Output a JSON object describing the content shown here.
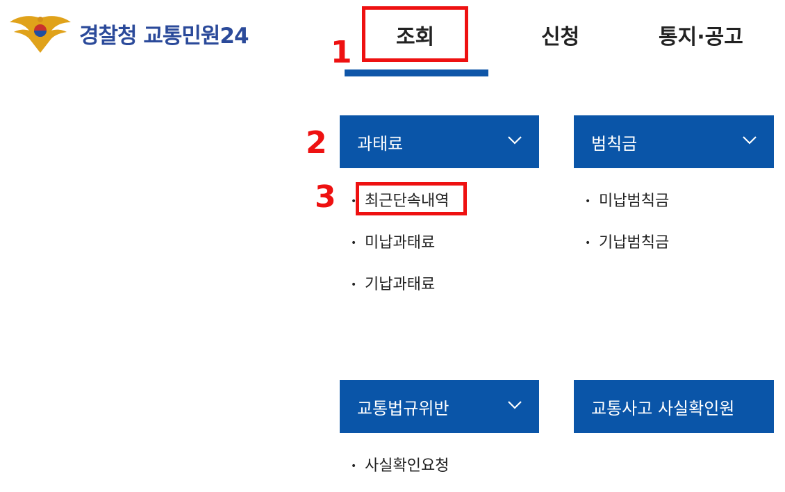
{
  "header": {
    "logo_text": "경찰청 교통민원24"
  },
  "nav": {
    "tabs": [
      {
        "label": "조회"
      },
      {
        "label": "신청"
      },
      {
        "label": "통지·공고"
      }
    ]
  },
  "annotations": {
    "n1": "1",
    "n2": "2",
    "n3": "3"
  },
  "menus": {
    "fine": {
      "title": "과태료",
      "items": [
        "최근단속내역",
        "미납과태료",
        "기납과태료"
      ]
    },
    "penalty": {
      "title": "범칙금",
      "items": [
        "미납범칙금",
        "기납범칙금"
      ]
    },
    "violation": {
      "title": "교통법규위반",
      "items": [
        "사실확인요청"
      ]
    },
    "accident": {
      "title": "교통사고 사실확인원"
    }
  },
  "colors": {
    "brand_blue": "#0a55a8",
    "highlight_red": "#ee1111"
  }
}
